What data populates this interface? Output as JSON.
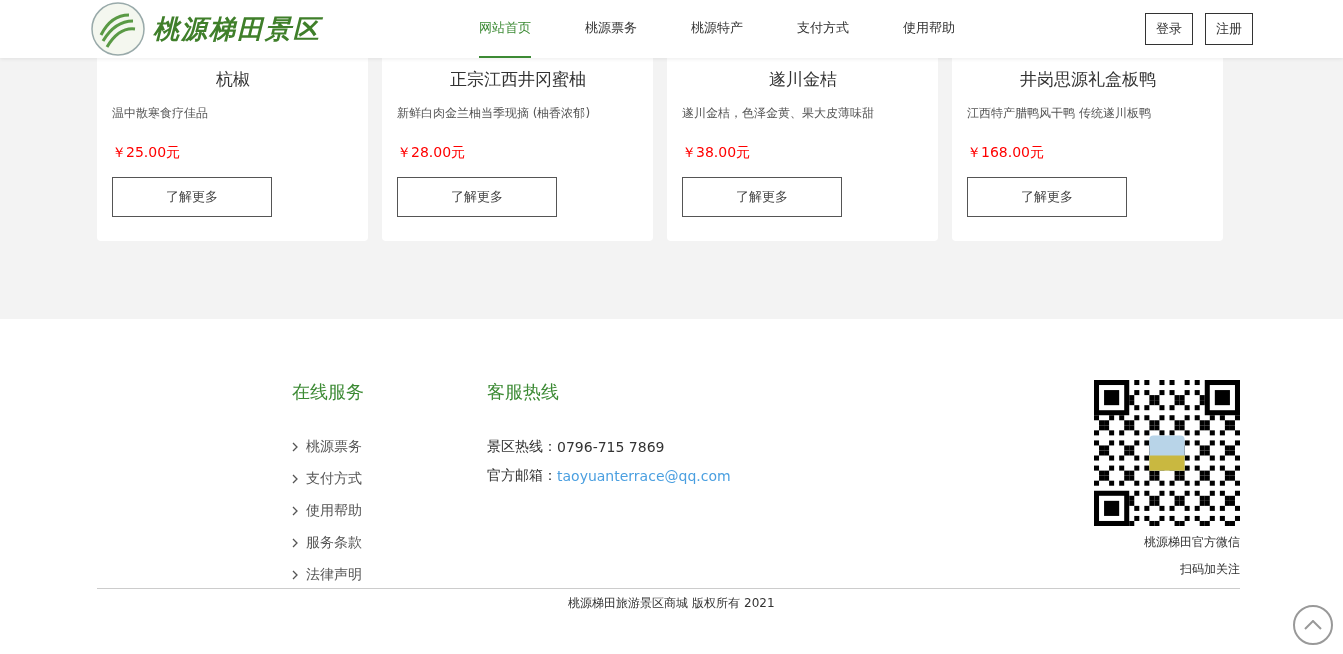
{
  "header": {
    "logo_text": "桃源梯田景区",
    "nav": [
      {
        "label": "网站首页",
        "selected": true
      },
      {
        "label": "桃源票务",
        "selected": false
      },
      {
        "label": "桃源特产",
        "selected": false
      },
      {
        "label": "支付方式",
        "selected": false
      },
      {
        "label": "使用帮助",
        "selected": false
      }
    ],
    "buttons": [
      "登录",
      "注册"
    ]
  },
  "products": [
    {
      "name": "杭椒",
      "description": "温中散寒食疗佳品",
      "price": "￥25.00元",
      "button": "了解更多"
    },
    {
      "name": "正宗江西井冈蜜柚",
      "description": "新鲜白肉金兰柚当季现摘 (柚香浓郁)",
      "price": "￥28.00元",
      "button": "了解更多"
    },
    {
      "name": "遂川金桔",
      "description": "遂川金桔，色泽金黄、果大皮薄味甜",
      "price": "￥38.00元",
      "button": "了解更多"
    },
    {
      "name": "井岗思源礼盒板鸭",
      "description": "江西特产腊鸭风干鸭 传统遂川板鸭",
      "price": "￥168.00元",
      "button": "了解更多"
    }
  ],
  "footer": {
    "services": {
      "title": "在线服务",
      "links": [
        "桃源票务",
        "支付方式",
        "使用帮助",
        "服务条款",
        "法律声明"
      ]
    },
    "hotline": {
      "title": "客服热线",
      "rows": [
        {
          "label": "景区热线：",
          "value": "0796-715 7869",
          "kind": "text"
        },
        {
          "label": "官方邮箱：",
          "value": "taoyuanterrace@qq.com",
          "kind": "link"
        }
      ]
    },
    "qr": {
      "caption": "桃源梯田官方微信",
      "sub_caption": "扫码加关注"
    },
    "copyright": "桃源梯田旅游景区商城 版权所有 2021"
  }
}
